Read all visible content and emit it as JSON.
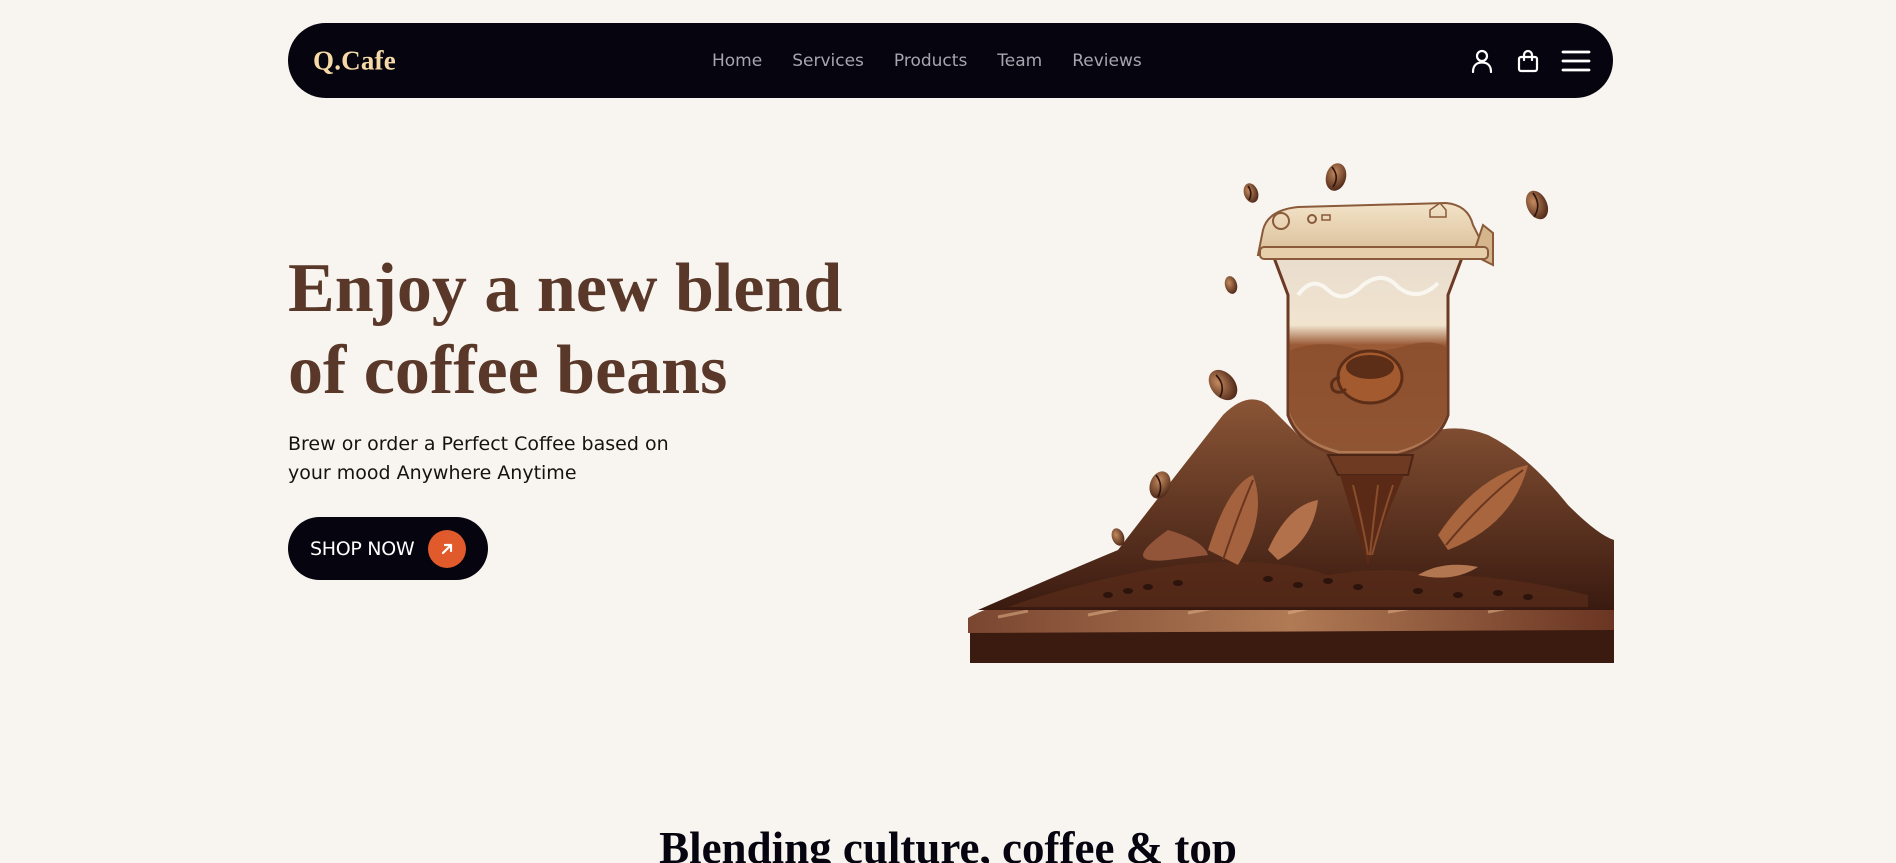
{
  "brand": {
    "logo": "Q.Cafe"
  },
  "nav": {
    "links": [
      "Home",
      "Services",
      "Products",
      "Team",
      "Reviews"
    ],
    "icons": [
      "user-icon",
      "shopping-bag-icon",
      "menu-icon"
    ]
  },
  "hero": {
    "title_line1": "Enjoy a new blend",
    "title_line2": "of coffee beans",
    "subtitle": "Brew or order a Perfect Coffee based on your mood Anywhere Anytime",
    "cta_label": "SHOP NOW",
    "cta_icon": "arrow-up-right-icon",
    "illustration": "coffee-grinder-illustration"
  },
  "section": {
    "heading": "Blending culture, coffee & top"
  },
  "colors": {
    "background": "#f8f4ef",
    "navbar": "#05040f",
    "logo": "#f5d9a6",
    "nav_link": "#a7a6ad",
    "hero_title": "#5a3829",
    "accent": "#e05a2c"
  }
}
